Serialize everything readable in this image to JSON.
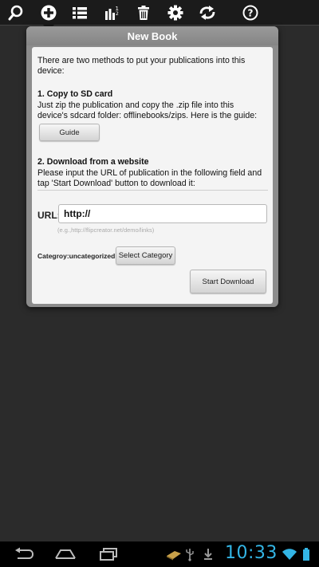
{
  "toolbar": {
    "icons": [
      "search-icon",
      "add-icon",
      "list-icon",
      "sort-icon",
      "delete-icon",
      "settings-icon",
      "sync-icon",
      "help-icon"
    ]
  },
  "dialog": {
    "title": "New Book",
    "intro_line1": "There are two methods to put your publications into this",
    "intro_line2": "device:",
    "section1_title": "1. Copy to SD card",
    "section1_line1": "Just zip the publication and copy the .zip file into this",
    "section1_line2": "device's sdcard folder: offlinebooks/zips. Here is the guide:",
    "guide_button": "Guide",
    "section2_title": "2. Download from a website",
    "section2_line1": "Please input the URL of publication in the following field and",
    "section2_line2": "tap 'Start Download' button to download it:",
    "url_label": "URL:",
    "url_value": "http://",
    "url_hint": "(e.g.,http://flipcreator.net/demo/links)",
    "category_label": "Categroy:uncategorized",
    "select_category_button": "Select Category",
    "start_download_button": "Start Download"
  },
  "statusbar": {
    "time": "10:33"
  },
  "colors": {
    "accent": "#33b5e5",
    "background": "#2b2b2b"
  }
}
